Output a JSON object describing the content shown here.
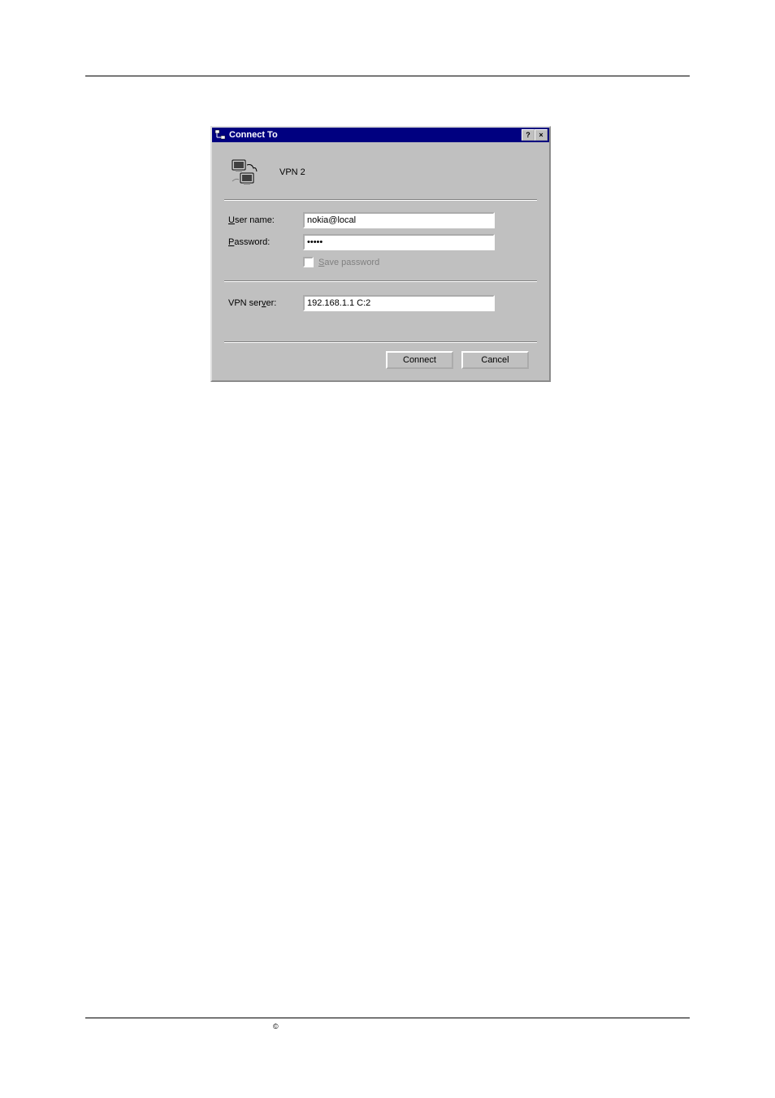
{
  "dialog": {
    "title": "Connect To",
    "helpButton": "?",
    "closeButton": "×",
    "vpnName": "VPN 2",
    "fields": {
      "username": {
        "label_prefix": "U",
        "label_rest": "ser name:",
        "value": "nokia@local"
      },
      "password": {
        "label_prefix": "P",
        "label_rest": "assword:",
        "value": "•••••"
      },
      "savePassword": {
        "label_prefix": "S",
        "label_rest": "ave password"
      },
      "vpnServer": {
        "label_pre": "VPN ser",
        "label_underline": "v",
        "label_post": "er:",
        "value": "192.168.1.1 C:2"
      }
    },
    "buttons": {
      "connect": "Connect",
      "cancel": "Cancel"
    }
  },
  "copyright": "©"
}
